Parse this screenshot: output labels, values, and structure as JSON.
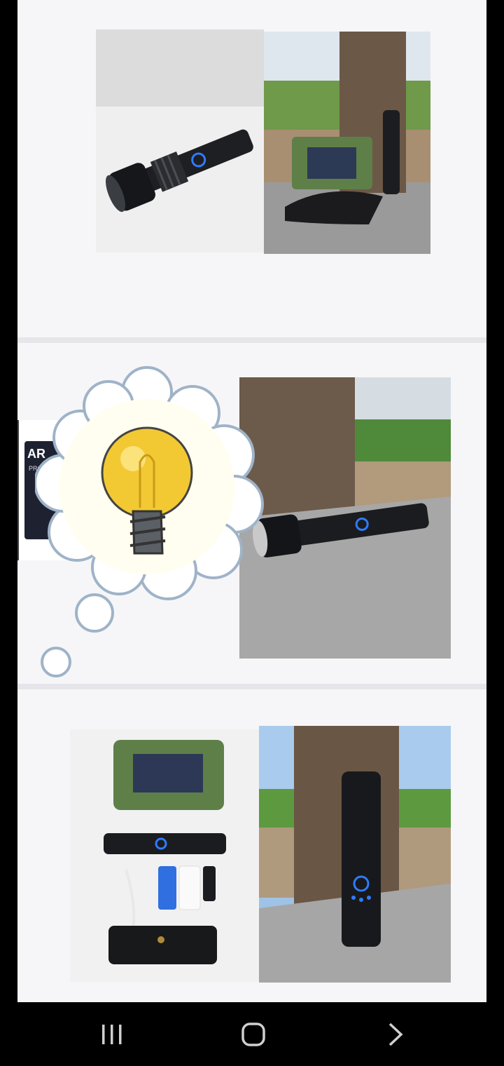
{
  "gallery": {
    "items": [
      {
        "name": "product-image-1"
      },
      {
        "name": "product-image-2"
      },
      {
        "name": "product-image-3"
      }
    ],
    "product": {
      "brand_text": "AR",
      "subtitle_text": "PROFES"
    }
  },
  "overlay": {
    "icon": "lightbulb-thought-bubble-icon"
  },
  "navbar": {
    "recents_icon": "recents-icon",
    "home_icon": "home-icon",
    "back_icon": "back-icon"
  },
  "colors": {
    "panel_bg": "#f6f6f8",
    "box_green": "#5f7f48",
    "bulb_yellow": "#f2c933",
    "led_blue": "#2f7bff"
  }
}
